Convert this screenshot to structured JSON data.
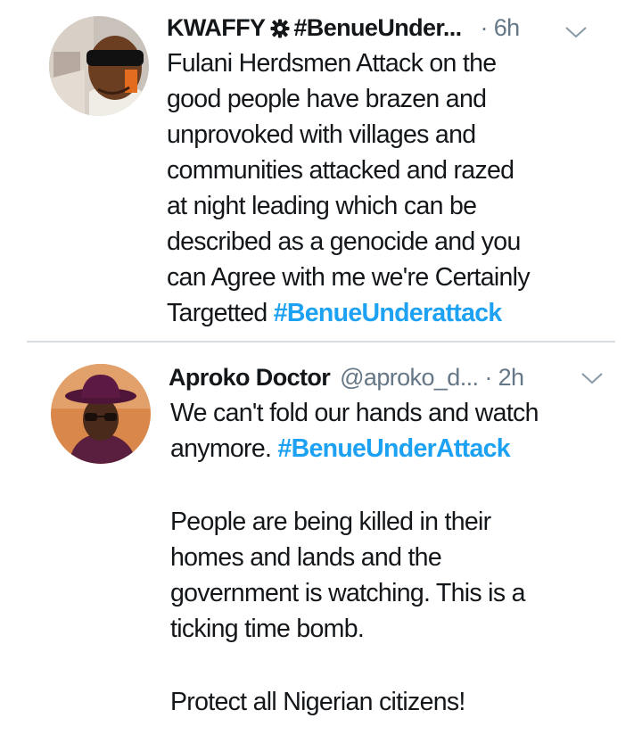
{
  "tweets": [
    {
      "author": "KWAFFY",
      "author_suffix": "#BenueUnder...",
      "time": "· 6h",
      "lines": [
        "Fulani Herdsmen Attack on the",
        "good people have brazen and",
        "unprovoked with villages and",
        "communities attacked and razed",
        "at night leading which can be",
        "described as a genocide and you",
        "can Agree with me we're Certainly"
      ],
      "last_line_text": "Targetted ",
      "last_line_hashtag": "#BenueUnderattack"
    },
    {
      "author": "Aproko Doctor",
      "handle": "@aproko_d...",
      "time": "· 2h",
      "p1_line1": "We can't fold our hands and watch",
      "p1_line2_text": "anymore. ",
      "p1_line2_hashtag": "#BenueUnderAttack",
      "p2_lines": [
        "People are being killed in their",
        "homes and lands and the",
        "government is watching. This is a",
        "ticking time bomb."
      ],
      "p3": "Protect all Nigerian citizens!"
    }
  ],
  "colors": {
    "hashtag": "#1da1f2",
    "muted": "#657786",
    "text": "#14171a"
  },
  "icons": [
    "gear-icon",
    "chevron-down-icon"
  ]
}
